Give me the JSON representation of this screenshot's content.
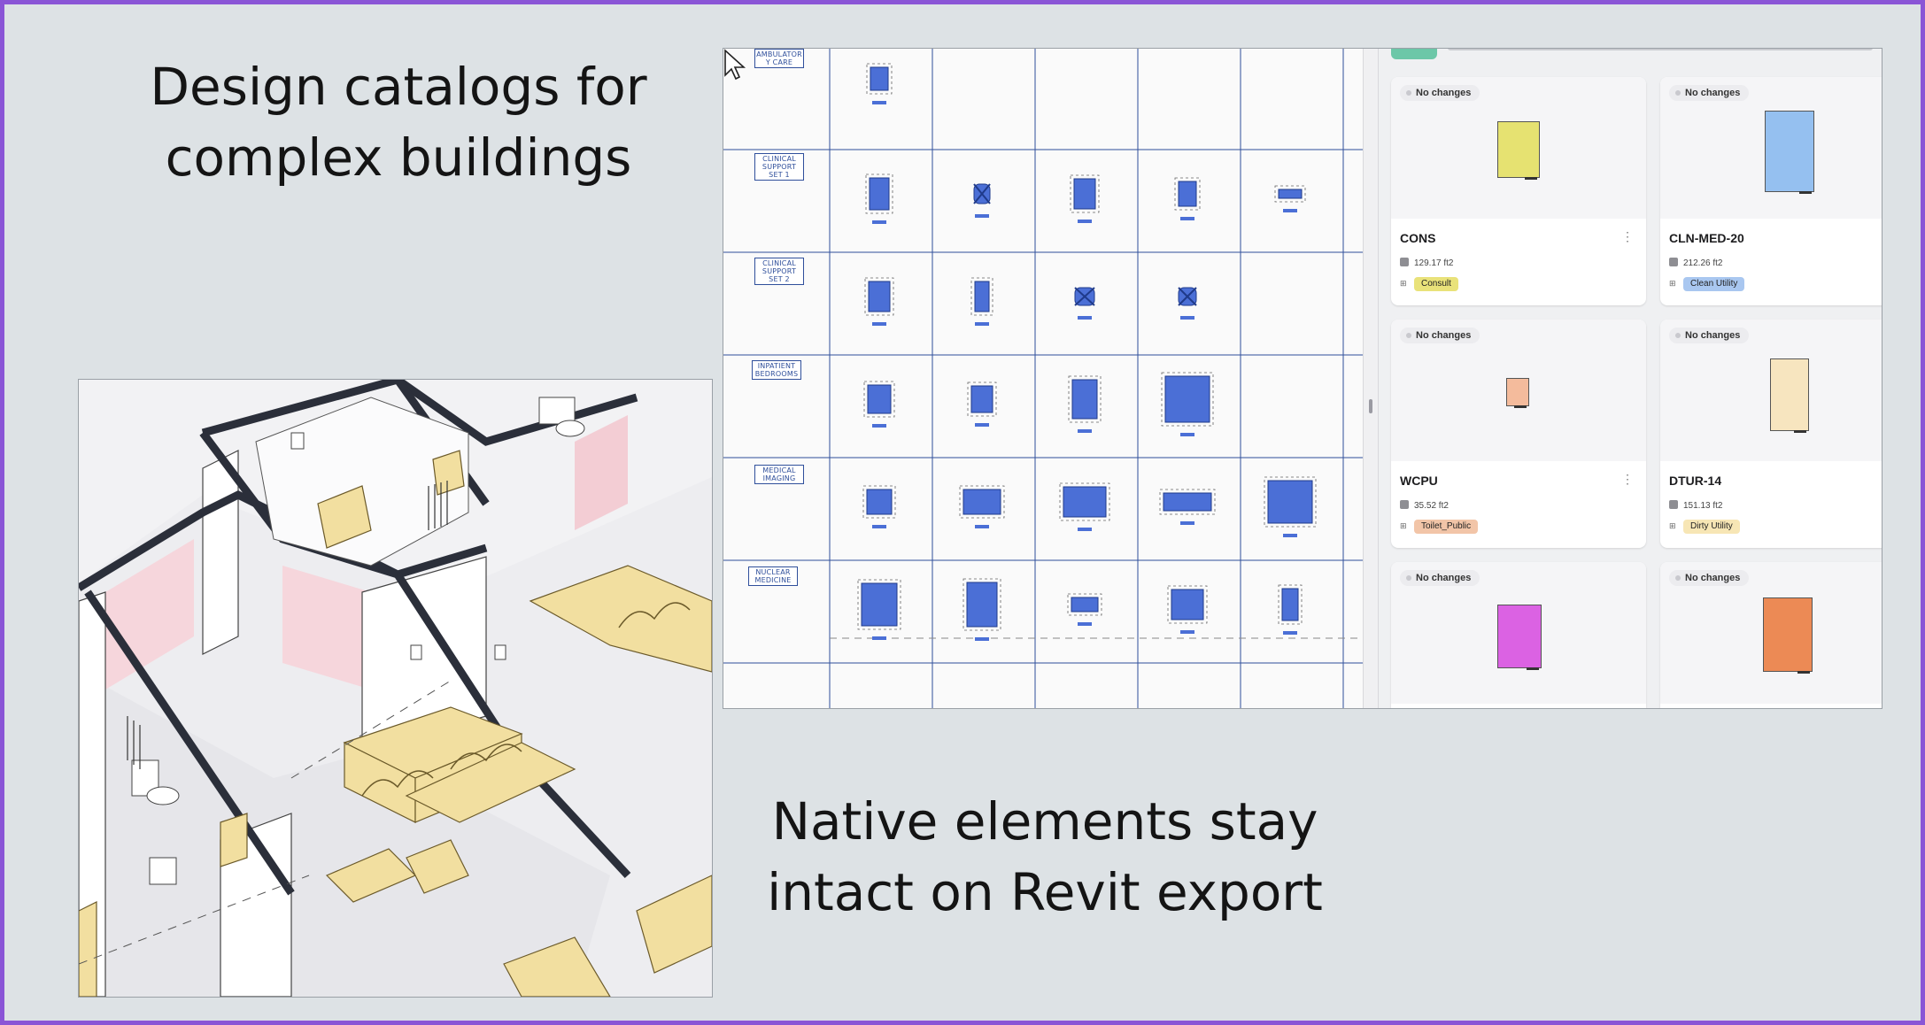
{
  "headlines": {
    "top": [
      "Design catalogs for",
      "complex buildings"
    ],
    "bottom": [
      "Native elements stay",
      "intact on Revit export"
    ]
  },
  "catalog_grid": {
    "rows": [
      {
        "label": [
          "AMBULATOR",
          "Y CARE"
        ]
      },
      {
        "label": [
          "CLINICAL",
          "SUPPORT",
          "SET 1"
        ]
      },
      {
        "label": [
          "CLINICAL",
          "SUPPORT",
          "SET 2"
        ]
      },
      {
        "label": [
          "INPATIENT",
          "BEDROOMS"
        ]
      },
      {
        "label": [
          "MEDICAL",
          "IMAGING"
        ]
      },
      {
        "label": [
          "NUCLEAR",
          "MEDICINE"
        ]
      }
    ]
  },
  "cards": [
    {
      "status": "No changes",
      "name": "CONS",
      "area": "129.17 ft2",
      "tag": "Consult",
      "tag_color": "#e9e27a",
      "shape_color": "#e6e271",
      "has_menu": true
    },
    {
      "status": "No changes",
      "name": "CLN-MED-20",
      "area": "212.26 ft2",
      "tag": "Clean Utility",
      "tag_color": "#a9c7f0",
      "shape_color": "#95c0f0",
      "has_menu": false
    },
    {
      "status": "No changes",
      "name": "WCPU",
      "area": "35.52 ft2",
      "tag": "Toilet_Public",
      "tag_color": "#f2c5a8",
      "shape_color": "#f4bb9c",
      "has_menu": true
    },
    {
      "status": "No changes",
      "name": "DTUR-14",
      "area": "151.13 ft2",
      "tag": "Dirty Utility",
      "tag_color": "#f7e6b5",
      "shape_color": "#f7e5bf",
      "has_menu": false
    },
    {
      "status": "No changes",
      "name": "",
      "area": "",
      "tag": "",
      "tag_color": "",
      "shape_color": "#db62e3",
      "has_menu": false
    },
    {
      "status": "No changes",
      "name": "",
      "area": "",
      "tag": "",
      "tag_color": "",
      "shape_color": "#ec8a55",
      "has_menu": false
    }
  ],
  "colors": {
    "frame": "#8a55d6",
    "background": "#dde2e5",
    "grid_blue": "#2f4f9b",
    "room_blue": "#4b6fd6",
    "furniture_yellow": "#f2dfa0",
    "wall_dark": "#2b2f3a"
  }
}
